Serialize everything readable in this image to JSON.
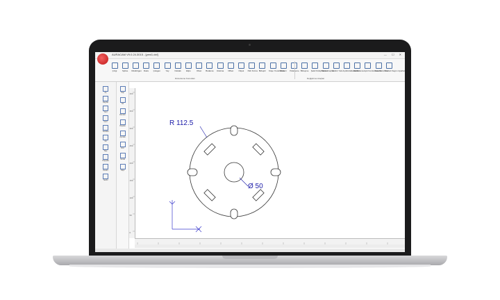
{
  "window": {
    "title": "AURACAM V9.0.24.3015 - [yeni1.dxf]",
    "controls": "—  ☐  ✕"
  },
  "ribbon": {
    "tools": [
      "Çizgi",
      "Spline",
      "Dikdörtgen",
      "Daire",
      "Çokgen",
      "Yay",
      "Noktalı",
      "Elips",
      "Ofset",
      "Budama",
      "Uzatma",
      "Offset",
      "Ölçek",
      "Pah Kırma",
      "Birleştir",
      "Köşe Yuvarlatma",
      "Pattern",
      "Paletleme",
      "Birleşme",
      "Şekil Kütüphanesi",
      "Metin Araçları",
      "Vektör Yazı",
      "Açıklık Eklenebilir",
      "Markalama",
      "Açık Kontur Kesme",
      "Hata Düzeltme",
      "Noktalı Sayıcı Ayarlama"
    ],
    "group_left": "Düzenleme Komutları",
    "group_right": "Değiştirme Araçları"
  },
  "left_panel": {
    "tools": [
      "Aç",
      "Kaydet",
      "Yeni",
      "Geri",
      "Yeniden",
      "Sil",
      "Taşı",
      "Kopyala",
      "Kesim",
      "Yazdır"
    ]
  },
  "tool_column": {
    "tools": [
      "Taşı",
      "Sil",
      "Döndür",
      "Ölçekle",
      "Aynala",
      "Dizi",
      "Sırala",
      "Ölçü"
    ]
  },
  "drawing": {
    "radius_label": "R 112.5",
    "diameter_label": "Ø 50",
    "color_dimension": "#1a1aa8",
    "color_geometry": "#333333",
    "color_axis": "#3a3acc"
  },
  "ruler_ticks": {
    "horizontal": [
      "-150",
      "-100",
      "-50",
      "0",
      "50",
      "100",
      "150",
      "200",
      "250",
      "300",
      "350",
      "400",
      "450"
    ],
    "vertical": [
      "400",
      "350",
      "300",
      "250",
      "200",
      "150",
      "100",
      "50",
      "0"
    ]
  }
}
